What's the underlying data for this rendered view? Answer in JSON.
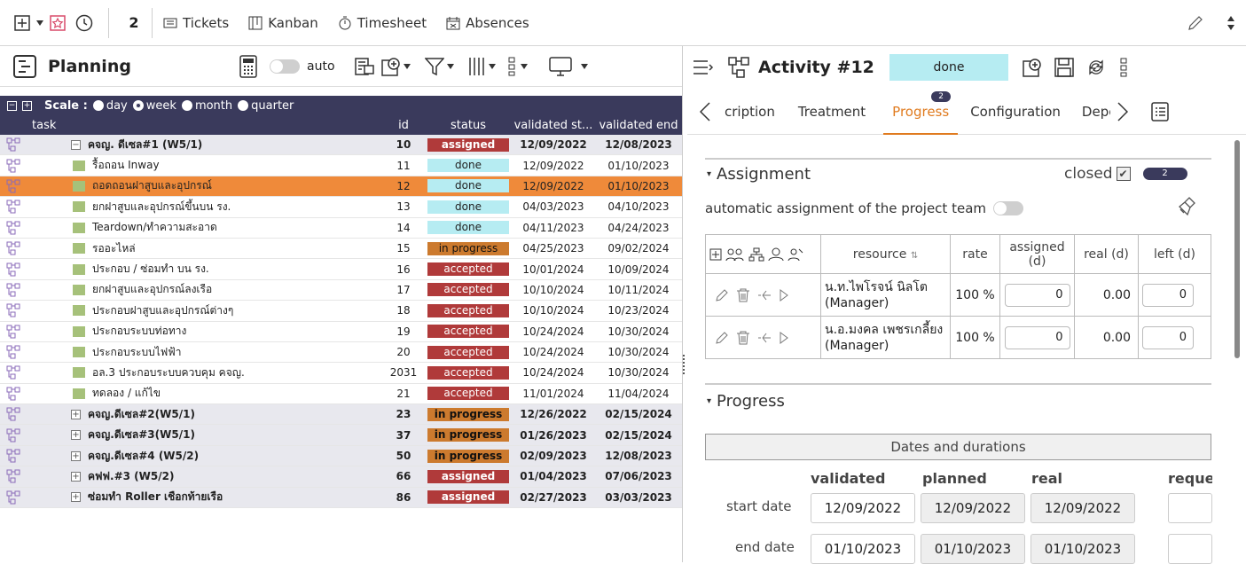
{
  "topbar": {
    "count": "2",
    "links": [
      {
        "label": "Tickets",
        "icon": "tickets-icon"
      },
      {
        "label": "Kanban",
        "icon": "kanban-icon"
      },
      {
        "label": "Timesheet",
        "icon": "timesheet-icon"
      },
      {
        "label": "Absences",
        "icon": "absences-icon"
      }
    ]
  },
  "planning": {
    "title": "Planning",
    "auto_label": "auto",
    "scale_label": "Scale :",
    "scale_options": [
      "day",
      "week",
      "month",
      "quarter"
    ],
    "selected_scale": "week",
    "columns": [
      "task",
      "id",
      "status",
      "validated st...",
      "validated end"
    ],
    "rows": [
      {
        "task": "คจญ. ดีเซล#1 (W5/1)",
        "id": "10",
        "status": "assigned",
        "start": "12/09/2022",
        "end": "12/08/2023",
        "parent": true,
        "expanded": true
      },
      {
        "task": "รื้อถอน Inway",
        "id": "11",
        "status": "done",
        "start": "12/09/2022",
        "end": "01/10/2023"
      },
      {
        "task": "ถอดถอนฝาสูบและอุปกรณ์",
        "id": "12",
        "status": "done",
        "start": "12/09/2022",
        "end": "01/10/2023",
        "selected": true
      },
      {
        "task": "ยกฝาสูบและอุปกรณ์ขึ้นบน รง.",
        "id": "13",
        "status": "done",
        "start": "04/03/2023",
        "end": "04/10/2023"
      },
      {
        "task": "Teardown/ทำความสะอาด",
        "id": "14",
        "status": "done",
        "start": "04/11/2023",
        "end": "04/24/2023"
      },
      {
        "task": "รออะไหล่",
        "id": "15",
        "status": "in progress",
        "start": "04/25/2023",
        "end": "09/02/2024"
      },
      {
        "task": "ประกอบ / ซ่อมทำ บน รง.",
        "id": "16",
        "status": "accepted",
        "start": "10/01/2024",
        "end": "10/09/2024"
      },
      {
        "task": "ยกฝาสูบและอุปกรณ์ลงเรือ",
        "id": "17",
        "status": "accepted",
        "start": "10/10/2024",
        "end": "10/11/2024"
      },
      {
        "task": "ประกอบฝาสูบและอุปกรณ์ต่างๆ",
        "id": "18",
        "status": "accepted",
        "start": "10/10/2024",
        "end": "10/23/2024"
      },
      {
        "task": "ประกอบระบบท่อทาง",
        "id": "19",
        "status": "accepted",
        "start": "10/24/2024",
        "end": "10/30/2024"
      },
      {
        "task": "ประกอบระบบไฟฟ้า",
        "id": "20",
        "status": "accepted",
        "start": "10/24/2024",
        "end": "10/30/2024"
      },
      {
        "task": "อล.3 ประกอบระบบควบคุม คจญ.",
        "id": "2031",
        "status": "accepted",
        "start": "10/24/2024",
        "end": "10/30/2024"
      },
      {
        "task": "ทดลอง / แก้ไข",
        "id": "21",
        "status": "accepted",
        "start": "11/01/2024",
        "end": "11/04/2024"
      },
      {
        "task": "คจญ.ดีเซล#2(W5/1)",
        "id": "23",
        "status": "in progress",
        "start": "12/26/2022",
        "end": "02/15/2024",
        "parent": true
      },
      {
        "task": "คจญ.ดีเซล#3(W5/1)",
        "id": "37",
        "status": "in progress",
        "start": "01/26/2023",
        "end": "02/15/2024",
        "parent": true
      },
      {
        "task": "คจญ.ดีเซล#4 (W5/2)",
        "id": "50",
        "status": "in progress",
        "start": "02/09/2023",
        "end": "12/08/2023",
        "parent": true
      },
      {
        "task": "คฟฟ.#3 (W5/2)",
        "id": "66",
        "status": "assigned",
        "start": "01/04/2023",
        "end": "07/06/2023",
        "parent": true
      },
      {
        "task": "ซ่อมทำ Roller เชือกท้ายเรือ",
        "id": "86",
        "status": "assigned",
        "start": "02/27/2023",
        "end": "03/03/2023",
        "parent": true
      }
    ]
  },
  "activity": {
    "title": "Activity  #12",
    "status": "done",
    "tabs": [
      "cription",
      "Treatment",
      "Progress",
      "Configuration",
      "Depe"
    ],
    "active_tab": "Progress",
    "progress_badge": "2",
    "assignment": {
      "title": "Assignment",
      "closed_label": "closed",
      "count_badge": "2",
      "auto_label": "automatic assignment of the project team",
      "headers": {
        "resource": "resource",
        "rate": "rate",
        "assigned": "assigned",
        "assigned_unit": "(d)",
        "real": "real (d)",
        "left": "left (d)"
      },
      "rows": [
        {
          "resource": "น.ท.ไพโรจน์ นิลโต (Manager)",
          "rate": "100 %",
          "assigned": "0",
          "real": "0.00",
          "left": "0"
        },
        {
          "resource": "น.อ.มงคล เพชรเกลี้ยง (Manager)",
          "rate": "100 %",
          "assigned": "0",
          "real": "0.00",
          "left": "0"
        }
      ]
    },
    "progress": {
      "title": "Progress",
      "dates_header": "Dates and durations",
      "col_validated": "validated",
      "col_planned": "planned",
      "col_real": "real",
      "col_requested": "reque",
      "start_label": "start date",
      "end_label": "end date",
      "start_validated": "12/09/2022",
      "start_planned": "12/09/2022",
      "start_real": "12/09/2022",
      "end_validated": "01/10/2023",
      "end_planned": "01/10/2023",
      "end_real": "01/10/2023"
    }
  }
}
